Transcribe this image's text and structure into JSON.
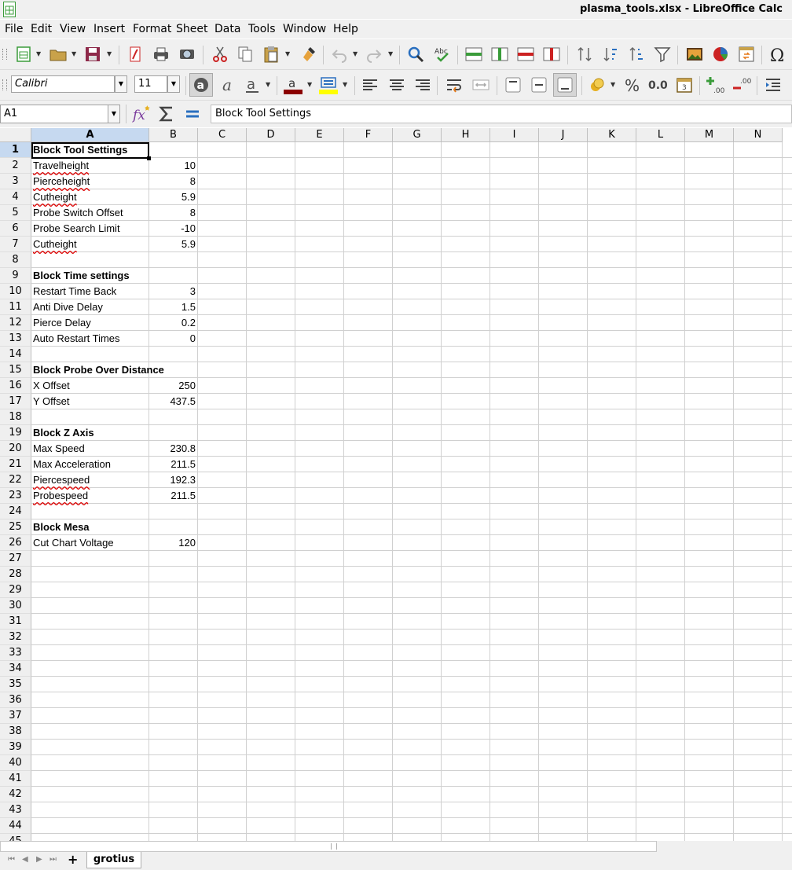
{
  "window": {
    "title": "plasma_tools.xlsx - LibreOffice Calc"
  },
  "menu": [
    "File",
    "Edit",
    "View",
    "Insert",
    "Format",
    "Sheet",
    "Data",
    "Tools",
    "Window",
    "Help"
  ],
  "format_toolbar": {
    "font_name": "Calibri",
    "font_size": "11"
  },
  "formula_bar": {
    "name_box": "A1",
    "content": "Block Tool Settings"
  },
  "columns": [
    "A",
    "B",
    "C",
    "D",
    "E",
    "F",
    "G",
    "H",
    "I",
    "J",
    "K",
    "L",
    "M",
    "N"
  ],
  "selected_cell": "A1",
  "rows_visible": [
    "1",
    "2",
    "3",
    "4",
    "5",
    "6",
    "7",
    "8",
    "9",
    "10",
    "11",
    "12",
    "13",
    "14",
    "15",
    "16",
    "17",
    "18",
    "19",
    "20",
    "21",
    "22",
    "23",
    "24",
    "25",
    "26",
    "27",
    "28",
    "29",
    "30",
    "31",
    "32",
    "33",
    "34",
    "35",
    "36",
    "37",
    "38",
    "39",
    "40",
    "41",
    "42",
    "43",
    "44",
    "45"
  ],
  "cells": {
    "A1": "Block Tool Settings",
    "A2": "Travelheight",
    "B2": "10",
    "A3": "Pierceheight",
    "B3": "8",
    "A4": "Cutheight",
    "B4": "5.9",
    "A5": "Probe Switch Offset",
    "B5": "8",
    "A6": "Probe Search Limit",
    "B6": "-10",
    "A7": "Cutheight",
    "B7": "5.9",
    "A9": "Block Time settings",
    "A10": "Restart Time Back",
    "B10": "3",
    "A11": "Anti Dive Delay",
    "B11": "1.5",
    "A12": "Pierce Delay",
    "B12": "0.2",
    "A13": "Auto Restart Times",
    "B13": "0",
    "A15": "Block Probe Over Distance",
    "A16": "X Offset",
    "B16": "250",
    "A17": "Y Offset",
    "B17": "437.5",
    "A19": "Block Z Axis",
    "A20": "Max Speed",
    "B20": "230.8",
    "A21": "Max Acceleration",
    "B21": "211.5",
    "A22": "Piercespeed",
    "B22": "192.3",
    "A23": "Probespeed",
    "B23": "211.5",
    "A25": "Block Mesa",
    "A26": "Cut Chart Voltage",
    "B26": "120"
  },
  "sheet_tabs": [
    "grotius"
  ],
  "add_sheet_label": "+",
  "colors": {
    "selection_header": "#c6d9f0",
    "spellcheck_underline": "#dd0000"
  }
}
